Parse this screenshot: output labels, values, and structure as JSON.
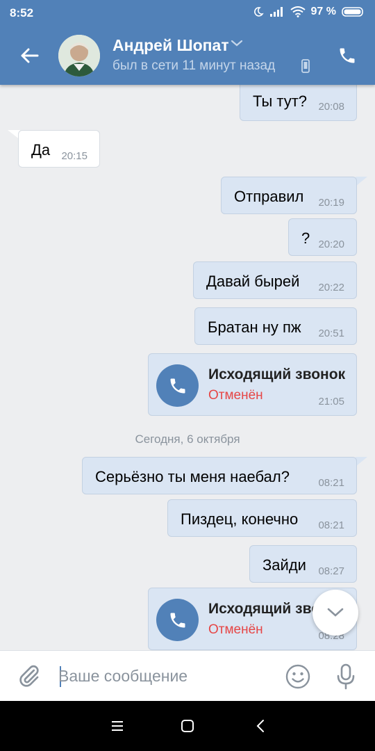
{
  "status_bar": {
    "time": "8:52",
    "battery": "97 %"
  },
  "header": {
    "contact_name": "Андрей Шопат",
    "contact_status": "был в сети 11 минут назад"
  },
  "messages": [
    {
      "text": "Ты тут?",
      "time": "20:08"
    },
    {
      "text": "Да",
      "time": "20:15"
    },
    {
      "text": "Отправил",
      "time": "20:19"
    },
    {
      "text": "?",
      "time": "20:20"
    },
    {
      "text": "Давай бырей",
      "time": "20:22"
    },
    {
      "text": "Братан ну пж",
      "time": "20:51"
    },
    {
      "title": "Исходящий звонок",
      "status": "Отменён",
      "time": "21:05"
    },
    {
      "text": "Серьёзно  ты меня наебал?",
      "time": "08:21"
    },
    {
      "text": "Пиздец, конечно",
      "time": "08:21"
    },
    {
      "text": "Зайди",
      "time": "08:27"
    },
    {
      "title": "Исходящий звонок",
      "status": "Отменён",
      "time": "08:28"
    }
  ],
  "date_separator": "Сегодня, 6 октября",
  "input": {
    "placeholder": "Ваше сообщение",
    "value": ""
  },
  "colors": {
    "header": "#5181b8",
    "outgoing_bubble": "#dae5f3",
    "incoming_bubble": "#ffffff",
    "cancelled": "#e64646"
  },
  "icons": [
    "back-arrow-icon",
    "chevron-down-icon",
    "phone-icon",
    "paperclip-icon",
    "smile-icon",
    "mic-icon",
    "chevron-down-icon"
  ]
}
